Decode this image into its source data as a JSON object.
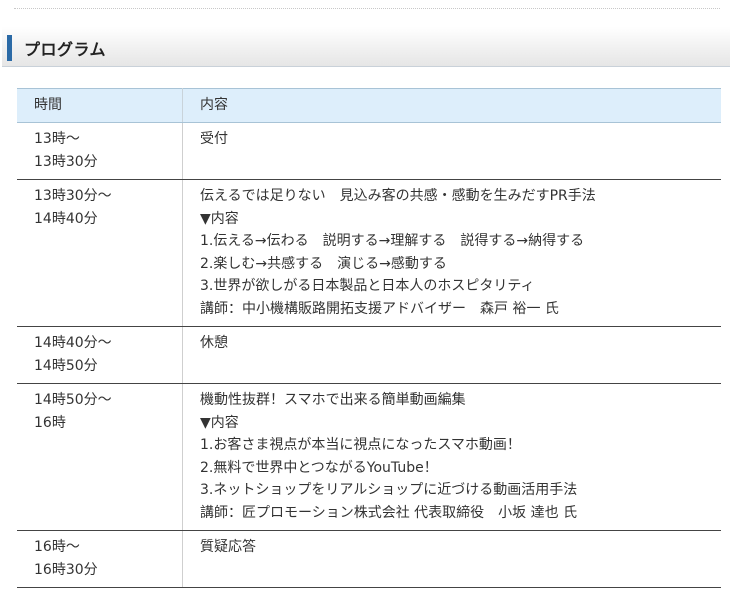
{
  "section": {
    "title": "プログラム"
  },
  "table": {
    "header": {
      "time": "時間",
      "content": "内容"
    },
    "rows": [
      {
        "time": [
          "13時～",
          "13時30分"
        ],
        "content": [
          "受付"
        ]
      },
      {
        "time": [
          "13時30分～",
          "14時40分"
        ],
        "content": [
          "伝えるでは足りない　見込み客の共感・感動を生みだすPR手法",
          "▼内容",
          "1.伝える→伝わる　説明する→理解する　説得する→納得する",
          "2.楽しむ→共感する　演じる→感動する",
          "3.世界が欲しがる日本製品と日本人のホスピタリティ",
          "講師：中小機構販路開拓支援アドバイザー　森戸 裕一 氏"
        ]
      },
      {
        "time": [
          "14時40分～",
          "14時50分"
        ],
        "content": [
          "休憩"
        ]
      },
      {
        "time": [
          "14時50分～",
          "16時"
        ],
        "content": [
          "機動性抜群！スマホで出来る簡単動画編集",
          "▼内容",
          "1.お客さま視点が本当に視点になったスマホ動画！",
          "2.無料で世界中とつながるYouTube！",
          "3.ネットショップをリアルショップに近づける動画活用手法",
          "講師：匠プロモーション株式会社 代表取締役　小坂 達也 氏"
        ]
      },
      {
        "time": [
          "16時～",
          "16時30分"
        ],
        "content": [
          "質疑応答"
        ]
      }
    ]
  }
}
